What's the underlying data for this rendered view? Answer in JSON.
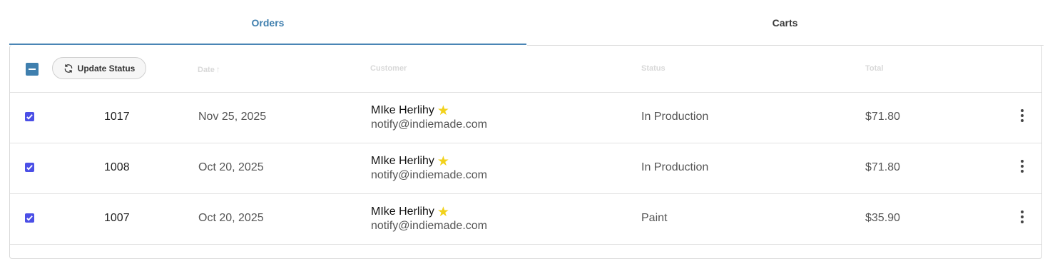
{
  "tabs": [
    {
      "label": "Orders",
      "active": true
    },
    {
      "label": "Carts",
      "active": false
    }
  ],
  "toolbar": {
    "update_status_label": "Update Status",
    "refresh_icon": "refresh-icon"
  },
  "columns": {
    "date": "Date",
    "customer": "Customer",
    "status": "Status",
    "total": "Total"
  },
  "rows": [
    {
      "id": "1017",
      "date": "Nov 25, 2025",
      "customer_name": "MIke Herlihy",
      "email": "notify@indiemade.com",
      "status": "In Production",
      "total": "$71.80",
      "checked": true
    },
    {
      "id": "1008",
      "date": "Oct 20, 2025",
      "customer_name": "MIke Herlihy",
      "email": "notify@indiemade.com",
      "status": "In Production",
      "total": "$71.80",
      "checked": true
    },
    {
      "id": "1007",
      "date": "Oct 20, 2025",
      "customer_name": "MIke Herlihy",
      "email": "notify@indiemade.com",
      "status": "Paint",
      "total": "$35.90",
      "checked": true
    }
  ],
  "colors": {
    "accent": "#3f7fae",
    "checkbox": "#4b4fe6",
    "star": "#f2d21b"
  }
}
